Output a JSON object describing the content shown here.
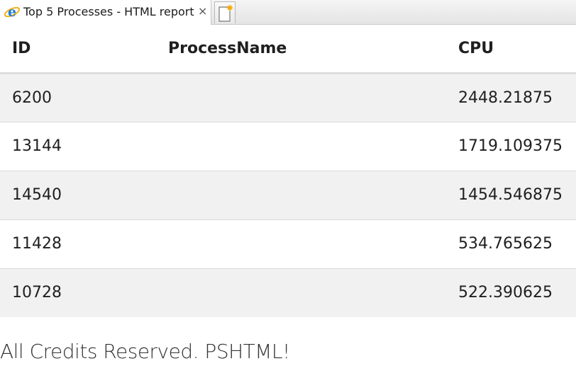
{
  "browser": {
    "tab_title": "Top 5 Processes - HTML report",
    "tab_close_glyph": "×",
    "tab_icon": "internet-explorer-icon",
    "new_tab_icon": "new-tab-icon"
  },
  "table": {
    "columns": [
      "ID",
      "ProcessName",
      "CPU"
    ],
    "rows": [
      {
        "id": "6200",
        "name": "",
        "cpu": "2448.21875"
      },
      {
        "id": "13144",
        "name": "",
        "cpu": "1719.109375"
      },
      {
        "id": "14540",
        "name": "",
        "cpu": "1454.546875"
      },
      {
        "id": "11428",
        "name": "",
        "cpu": "534.765625"
      },
      {
        "id": "10728",
        "name": "",
        "cpu": "522.390625"
      }
    ],
    "colors": {
      "odd_row": "#f1f1f1",
      "even_row": "#ffffff",
      "header_rule": "#dcdcdc"
    }
  },
  "footer": {
    "text": "All Credits Reserved. PSHTML!"
  }
}
